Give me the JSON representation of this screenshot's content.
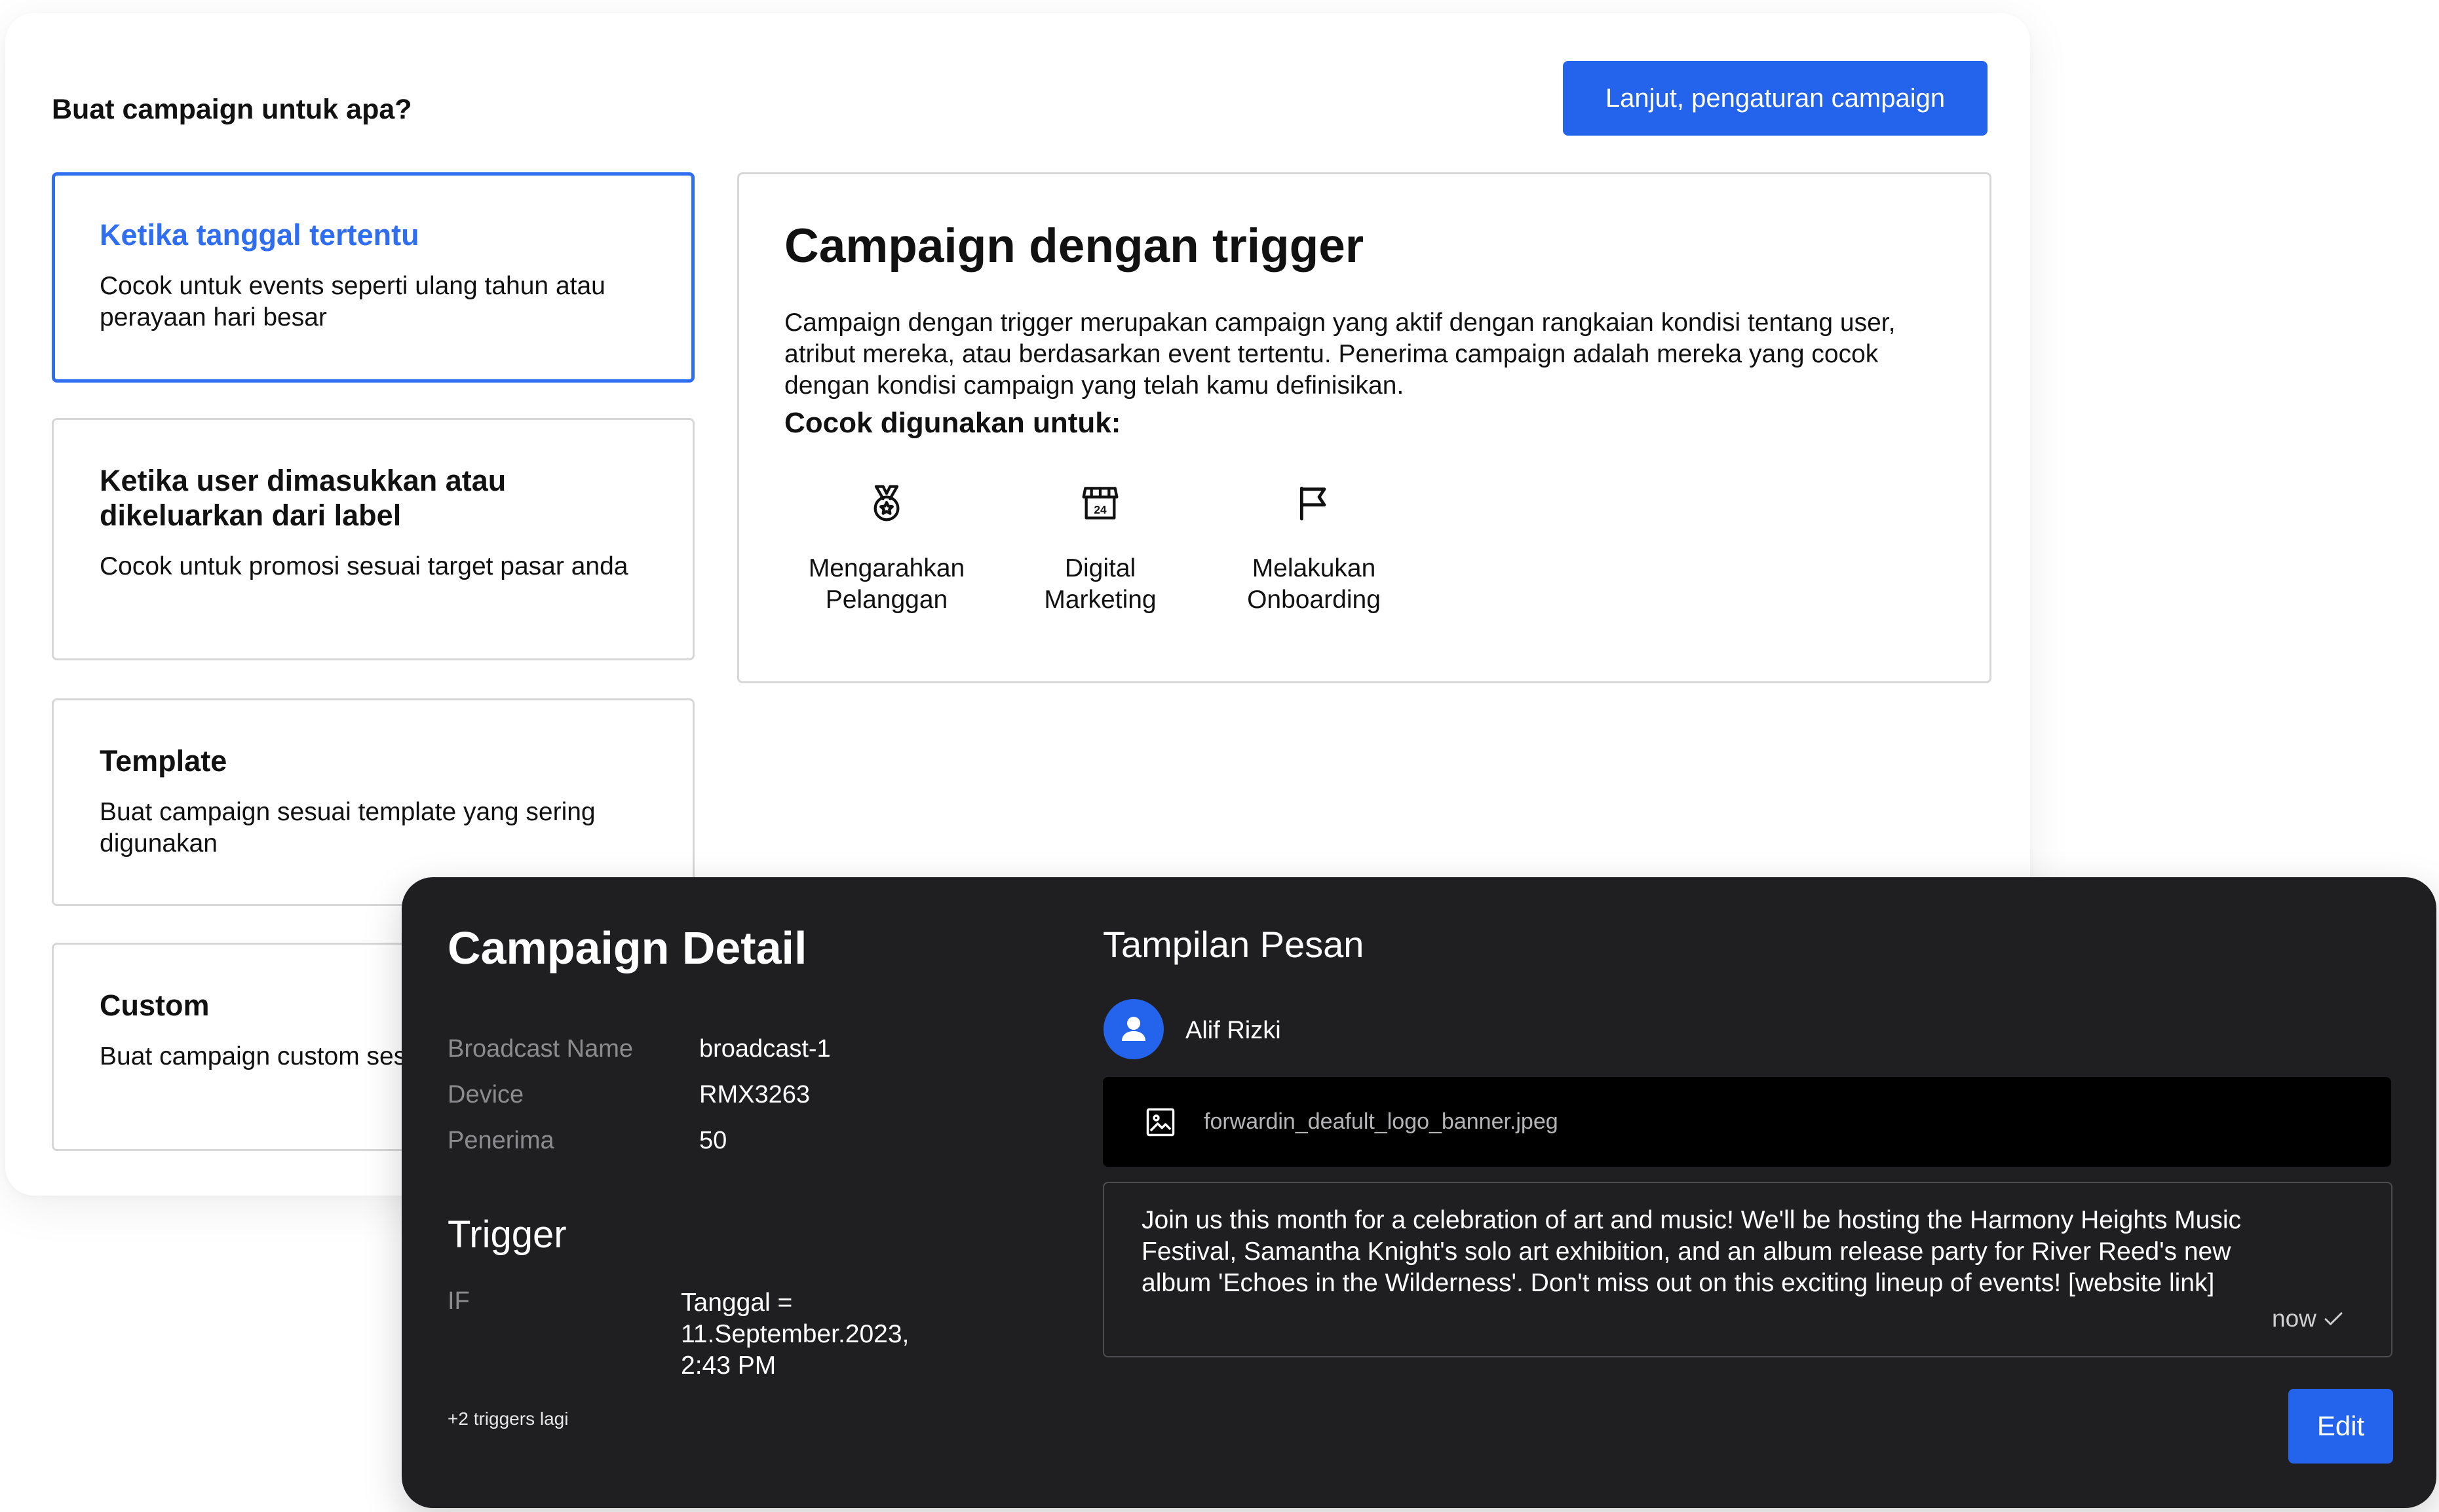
{
  "wizard": {
    "heading": "Buat campaign untuk apa?",
    "next_button": "Lanjut, pengaturan campaign",
    "options": [
      {
        "title": "Ketika tanggal tertentu",
        "desc": "Cocok untuk events seperti ulang tahun atau perayaan hari besar"
      },
      {
        "title": "Ketika user dimasukkan atau dikeluarkan dari label",
        "desc": "Cocok untuk promosi sesuai target pasar anda"
      },
      {
        "title": "Template",
        "desc": "Buat campaign sesuai template yang sering digunakan"
      },
      {
        "title": "Custom",
        "desc": "Buat campaign custom sesuai kebutuhan anda"
      }
    ],
    "info": {
      "title": "Campaign dengan trigger",
      "desc": "Campaign dengan trigger merupakan campaign yang aktif dengan rangkaian kondisi tentang user, atribut mereka, atau berdasarkan event tertentu. Penerima campaign adalah mereka yang cocok dengan kondisi campaign yang telah kamu definisikan.",
      "subheading": "Cocok digunakan untuk:",
      "uses": [
        {
          "label": "Mengarahkan Pelanggan",
          "icon": "medal-icon"
        },
        {
          "label": "Digital Marketing",
          "icon": "store-24-icon"
        },
        {
          "label": "Melakukan Onboarding",
          "icon": "flag-icon"
        }
      ]
    }
  },
  "detail": {
    "title": "Campaign Detail",
    "fields": [
      {
        "label": "Broadcast Name",
        "value": "broadcast-1"
      },
      {
        "label": "Device",
        "value": "RMX3263"
      },
      {
        "label": "Penerima",
        "value": "50"
      }
    ],
    "trigger_heading": "Trigger",
    "trigger_condition": "IF",
    "trigger_value": "Tanggal = 11.September.2023, 2:43 PM",
    "more_triggers": "+2 triggers lagi",
    "message_heading": "Tampilan Pesan",
    "sender": "Alif Rizki",
    "attachment": "forwardin_deafult_logo_banner.jpeg",
    "message": "Join us this month for a celebration of art and music! We'll be hosting the Harmony Heights Music Festival, Samantha Knight's solo art exhibition, and an album release party for River Reed's new album 'Echoes in the Wilderness'. Don't miss out on this exciting lineup of events! [website link]",
    "time": "now",
    "edit_button": "Edit"
  },
  "colors": {
    "accent": "#2463eb",
    "selected_border": "#2f6ef0",
    "dark_card": "#1f1f21",
    "attachment_bg": "#000000"
  }
}
